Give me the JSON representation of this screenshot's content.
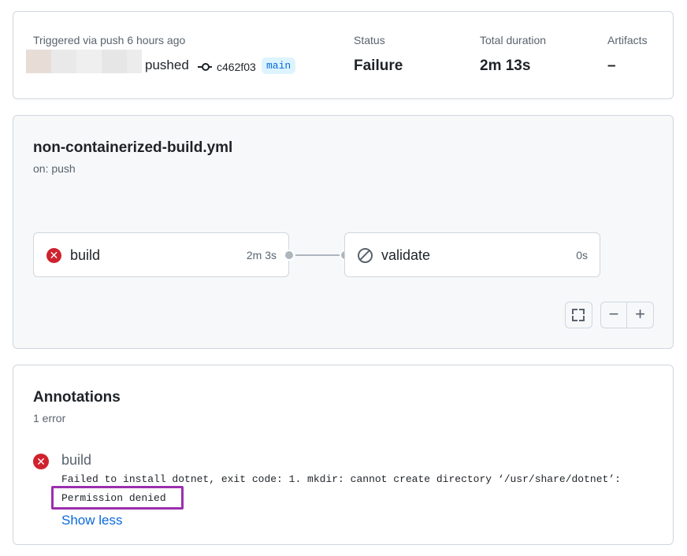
{
  "summary": {
    "trigger_text": "Triggered via push 6 hours ago",
    "action": "pushed",
    "commit_sha": "c462f03",
    "branch": "main",
    "status_label": "Status",
    "status_value": "Failure",
    "duration_label": "Total duration",
    "duration_value": "2m 13s",
    "artifacts_label": "Artifacts",
    "artifacts_value": "–"
  },
  "workflow": {
    "file_name": "non-containerized-build.yml",
    "trigger": "on: push",
    "jobs": [
      {
        "name": "build",
        "duration": "2m 3s",
        "status": "failure",
        "icon": "x-circle-fill-icon"
      },
      {
        "name": "validate",
        "duration": "0s",
        "status": "skipped",
        "icon": "skip-icon"
      }
    ],
    "controls": {
      "fullscreen": "fullscreen-icon",
      "zoom_out": "−",
      "zoom_in": "+"
    }
  },
  "annotations": {
    "title": "Annotations",
    "count": "1 error",
    "items": [
      {
        "job": "build",
        "icon": "x-circle-fill-icon",
        "message_line1": "Failed to install dotnet, exit code: 1. mkdir: cannot create directory ‘/usr/share/dotnet’:",
        "message_line2": "Permission denied",
        "toggle": "Show less"
      }
    ]
  },
  "colors": {
    "failure": "#cf222e",
    "link": "#0969da",
    "highlight": "#9b2fae",
    "branch_bg": "#ddf4ff"
  }
}
